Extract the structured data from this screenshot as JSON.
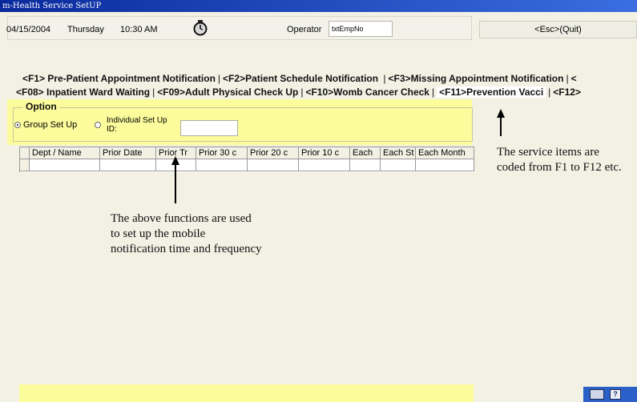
{
  "window": {
    "title": "m-Health Service SetUP"
  },
  "header": {
    "date": "04/15/2004",
    "day": "Thursday",
    "time": "10:30 AM",
    "operator_label": "Operator",
    "operator_value": "txtEmpNo",
    "esc_label": "<Esc>(Quit)"
  },
  "tabs": {
    "row1": [
      "<F1> Pre-Patient Appointment Notification",
      "<F2>Patient Schedule Notification",
      "<F3>Missing Appointment Notification",
      "<"
    ],
    "row2": [
      "<F08> Inpatient Ward Waiting",
      "<F09>Adult Physical Check Up",
      "<F10>Womb Cancer Check",
      "<F11>Prevention Vacci",
      "<F12>"
    ],
    "active_index_row2": 3
  },
  "option": {
    "legend": "Option",
    "group_label": "Group Set Up",
    "individual_label": "Individual Set Up ID:",
    "selected": "group"
  },
  "grid": {
    "columns": [
      "Dept / Name",
      "Prior Date",
      "Prior Tr",
      "Prior 30 c",
      "Prior 20 c",
      "Prior 10 c",
      "Each",
      "Each St",
      "Each Month"
    ]
  },
  "annotations": {
    "functions": "The above functions are used to set up the mobile notification time and frequency",
    "service": "The service items are coded from F1 to F12 etc."
  },
  "tray": {
    "help_glyph": "?"
  },
  "colors": {
    "titlebar": "#0a2a9c",
    "option_bg": "#fcfc9c",
    "window_bg": "#f2f1e4"
  }
}
